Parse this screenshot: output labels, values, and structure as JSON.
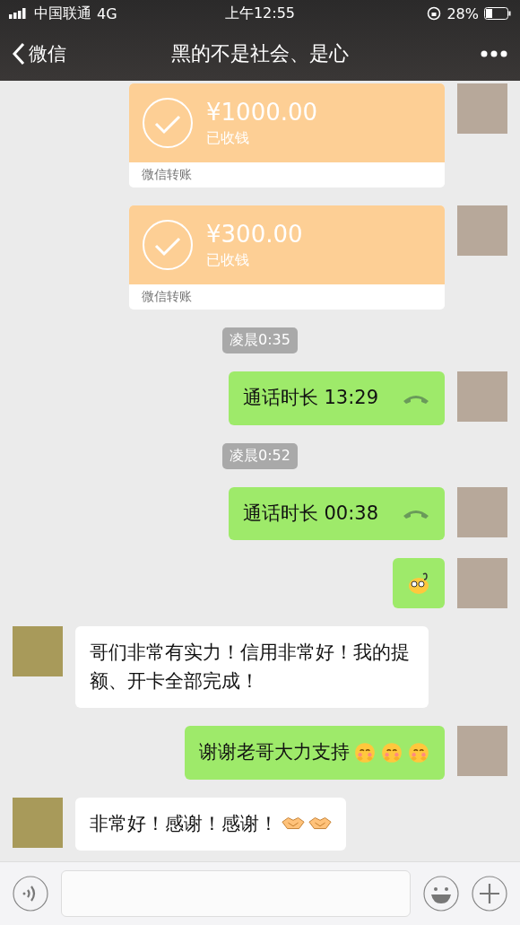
{
  "status_bar": {
    "carrier": "中国联通",
    "network": "4G",
    "time": "上午12:55",
    "battery_text": "28%"
  },
  "nav": {
    "back_label": "微信",
    "title": "黑的不是社会、是心"
  },
  "messages": [
    {
      "kind": "transfer",
      "outgoing": true,
      "amount": "¥1000.00",
      "status": "已收钱",
      "footer": "微信转账"
    },
    {
      "kind": "transfer",
      "outgoing": true,
      "amount": "¥300.00",
      "status": "已收钱",
      "footer": "微信转账"
    },
    {
      "kind": "timestamp",
      "text": "凌晨0:35"
    },
    {
      "kind": "call",
      "outgoing": true,
      "text": "通话时长 13:29"
    },
    {
      "kind": "timestamp",
      "text": "凌晨0:52"
    },
    {
      "kind": "call",
      "outgoing": true,
      "text": "通话时长 00:38"
    },
    {
      "kind": "sticker",
      "outgoing": true
    },
    {
      "kind": "text",
      "outgoing": false,
      "text": "哥们非常有实力！信用非常好！我的提额、开卡全部完成！"
    },
    {
      "kind": "text",
      "outgoing": true,
      "text": "谢谢老哥大力支持",
      "emoji": [
        {
          "kind": "blush"
        },
        {
          "kind": "blush"
        },
        {
          "kind": "blush"
        }
      ]
    },
    {
      "kind": "text",
      "outgoing": false,
      "text": "非常好！感谢！感谢！",
      "emoji": [
        {
          "kind": "handshake"
        },
        {
          "kind": "handshake"
        }
      ]
    }
  ]
}
